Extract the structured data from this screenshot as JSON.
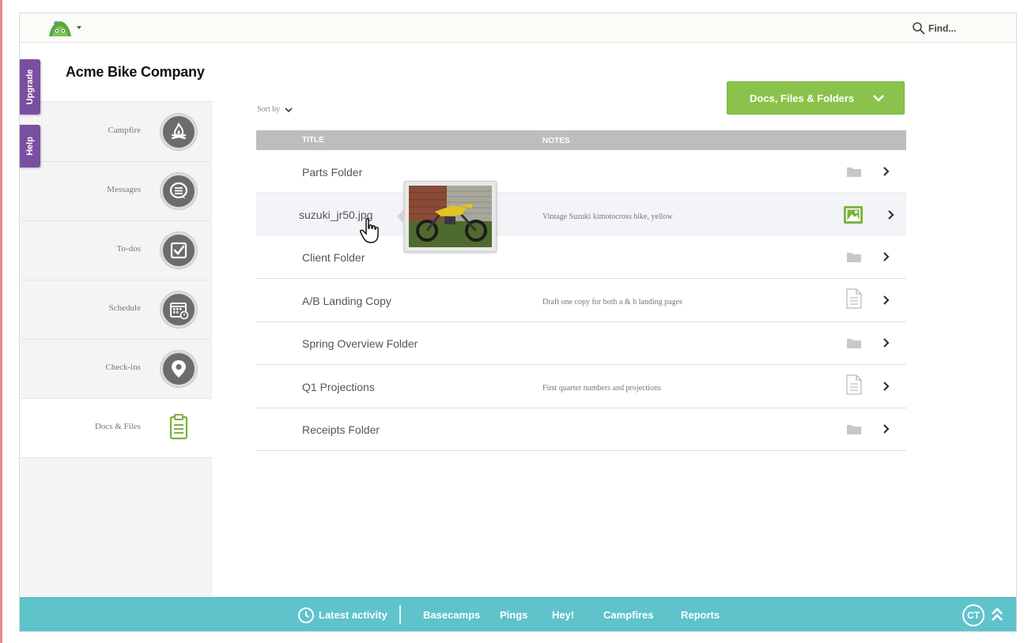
{
  "colors": {
    "accent_green": "#8bc24b",
    "footer_teal": "#5fc3cc",
    "side_tab_purple": "#7a4f9f",
    "table_header_gray": "#bdbdbd"
  },
  "topbar": {
    "find_label": "Find...",
    "logo_icon": "basecamp-logo-icon"
  },
  "sidebar": {
    "company_name": "Acme Bike Company",
    "tabs": {
      "upgrade": "Upgrade",
      "help": "Help"
    },
    "items": [
      {
        "label": "Campfire",
        "icon": "campfire-icon"
      },
      {
        "label": "Messages",
        "icon": "message-icon"
      },
      {
        "label": "To-dos",
        "icon": "checkbox-icon"
      },
      {
        "label": "Schedule",
        "icon": "calendar-icon"
      },
      {
        "label": "Check-ins",
        "icon": "location-pin-icon"
      },
      {
        "label": "Docs & Files",
        "icon": "document-icon",
        "active": true
      }
    ]
  },
  "main": {
    "sort_by_label": "Sort by",
    "filter_dropdown": "Docs, Files & Folders",
    "columns": {
      "title": "TITLE",
      "notes": "NOTES"
    },
    "rows": [
      {
        "title": "Parts Folder",
        "notes": "",
        "type": "folder"
      },
      {
        "title": "suzuki_jr50.jpg",
        "notes": "Vintage Suzuki kimotocross bike, yellow",
        "type": "image"
      },
      {
        "title": "Client Folder",
        "notes": "",
        "type": "folder"
      },
      {
        "title": "A/B Landing Copy",
        "notes": "Draft one copy for both a & b landing pages",
        "type": "document"
      },
      {
        "title": "Spring Overview Folder",
        "notes": "",
        "type": "folder"
      },
      {
        "title": "Q1 Projections",
        "notes": "First quarter numbers and projections",
        "type": "document"
      },
      {
        "title": "Receipts Folder",
        "notes": "",
        "type": "folder"
      }
    ]
  },
  "footer": {
    "latest_activity": "Latest activity",
    "links": [
      "Basecamps",
      "Pings",
      "Hey!",
      "Campfires",
      "Reports"
    ],
    "badge": "CT"
  }
}
